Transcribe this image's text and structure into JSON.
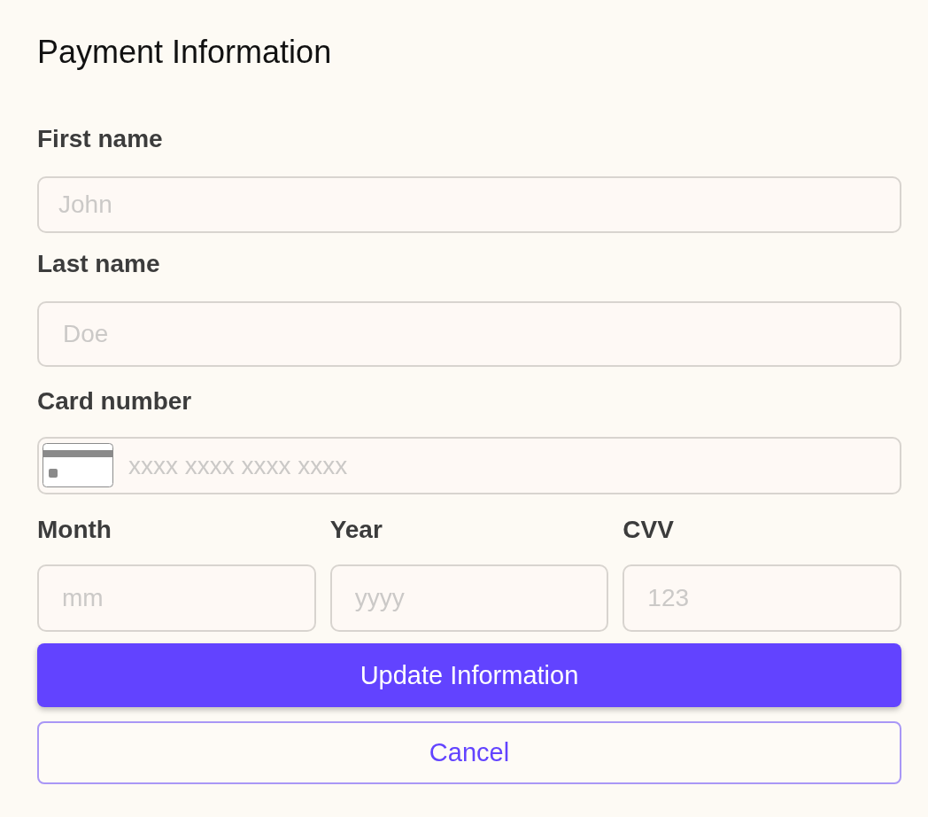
{
  "title": "Payment Information",
  "fields": [
    {
      "kind": "text",
      "label": "First name",
      "placeholder": "John"
    },
    {
      "kind": "text",
      "label": "Last name",
      "placeholder": "Doe"
    },
    {
      "kind": "card",
      "label": "Card number",
      "placeholder": "xxxx xxxx xxxx xxxx"
    }
  ],
  "details_row": [
    {
      "label": "Month",
      "placeholder": "mm"
    },
    {
      "label": "Year",
      "placeholder": "yyyy"
    },
    {
      "label": "CVV",
      "placeholder": "123"
    }
  ],
  "buttons": [
    {
      "kind": "primary",
      "label": "Update Information"
    },
    {
      "kind": "secondary",
      "label": "Cancel"
    }
  ]
}
